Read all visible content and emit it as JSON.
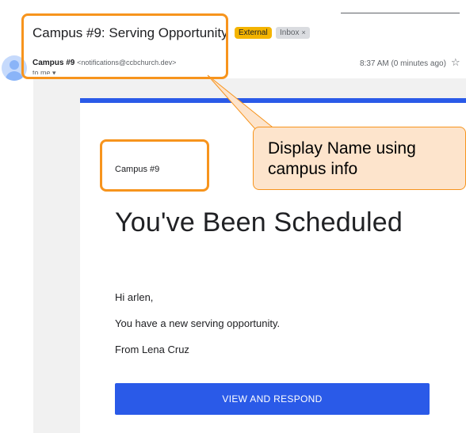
{
  "email": {
    "subject": "Campus #9: Serving Opportunity",
    "labels": {
      "external": "External",
      "inbox": "Inbox",
      "inbox_close": "×"
    },
    "sender_name": "Campus #9",
    "sender_address": "<notifications@ccbchurch.dev>",
    "to_line": "to me ▾",
    "timestamp": "8:37 AM (0 minutes ago)",
    "star_glyph": "☆"
  },
  "message": {
    "campus_name": "Campus #9",
    "heading": "You've Been Scheduled",
    "greeting": "Hi arlen,",
    "body": "You have a new serving opportunity.",
    "from": "From Lena Cruz",
    "cta_label": "VIEW AND RESPOND"
  },
  "annotation": {
    "callout_text": "Display Name using campus info"
  },
  "colors": {
    "accent_blue": "#2a5ae8",
    "highlight_orange": "#f7941d",
    "callout_fill": "#fde4cc",
    "external_label": "#f4b400"
  }
}
